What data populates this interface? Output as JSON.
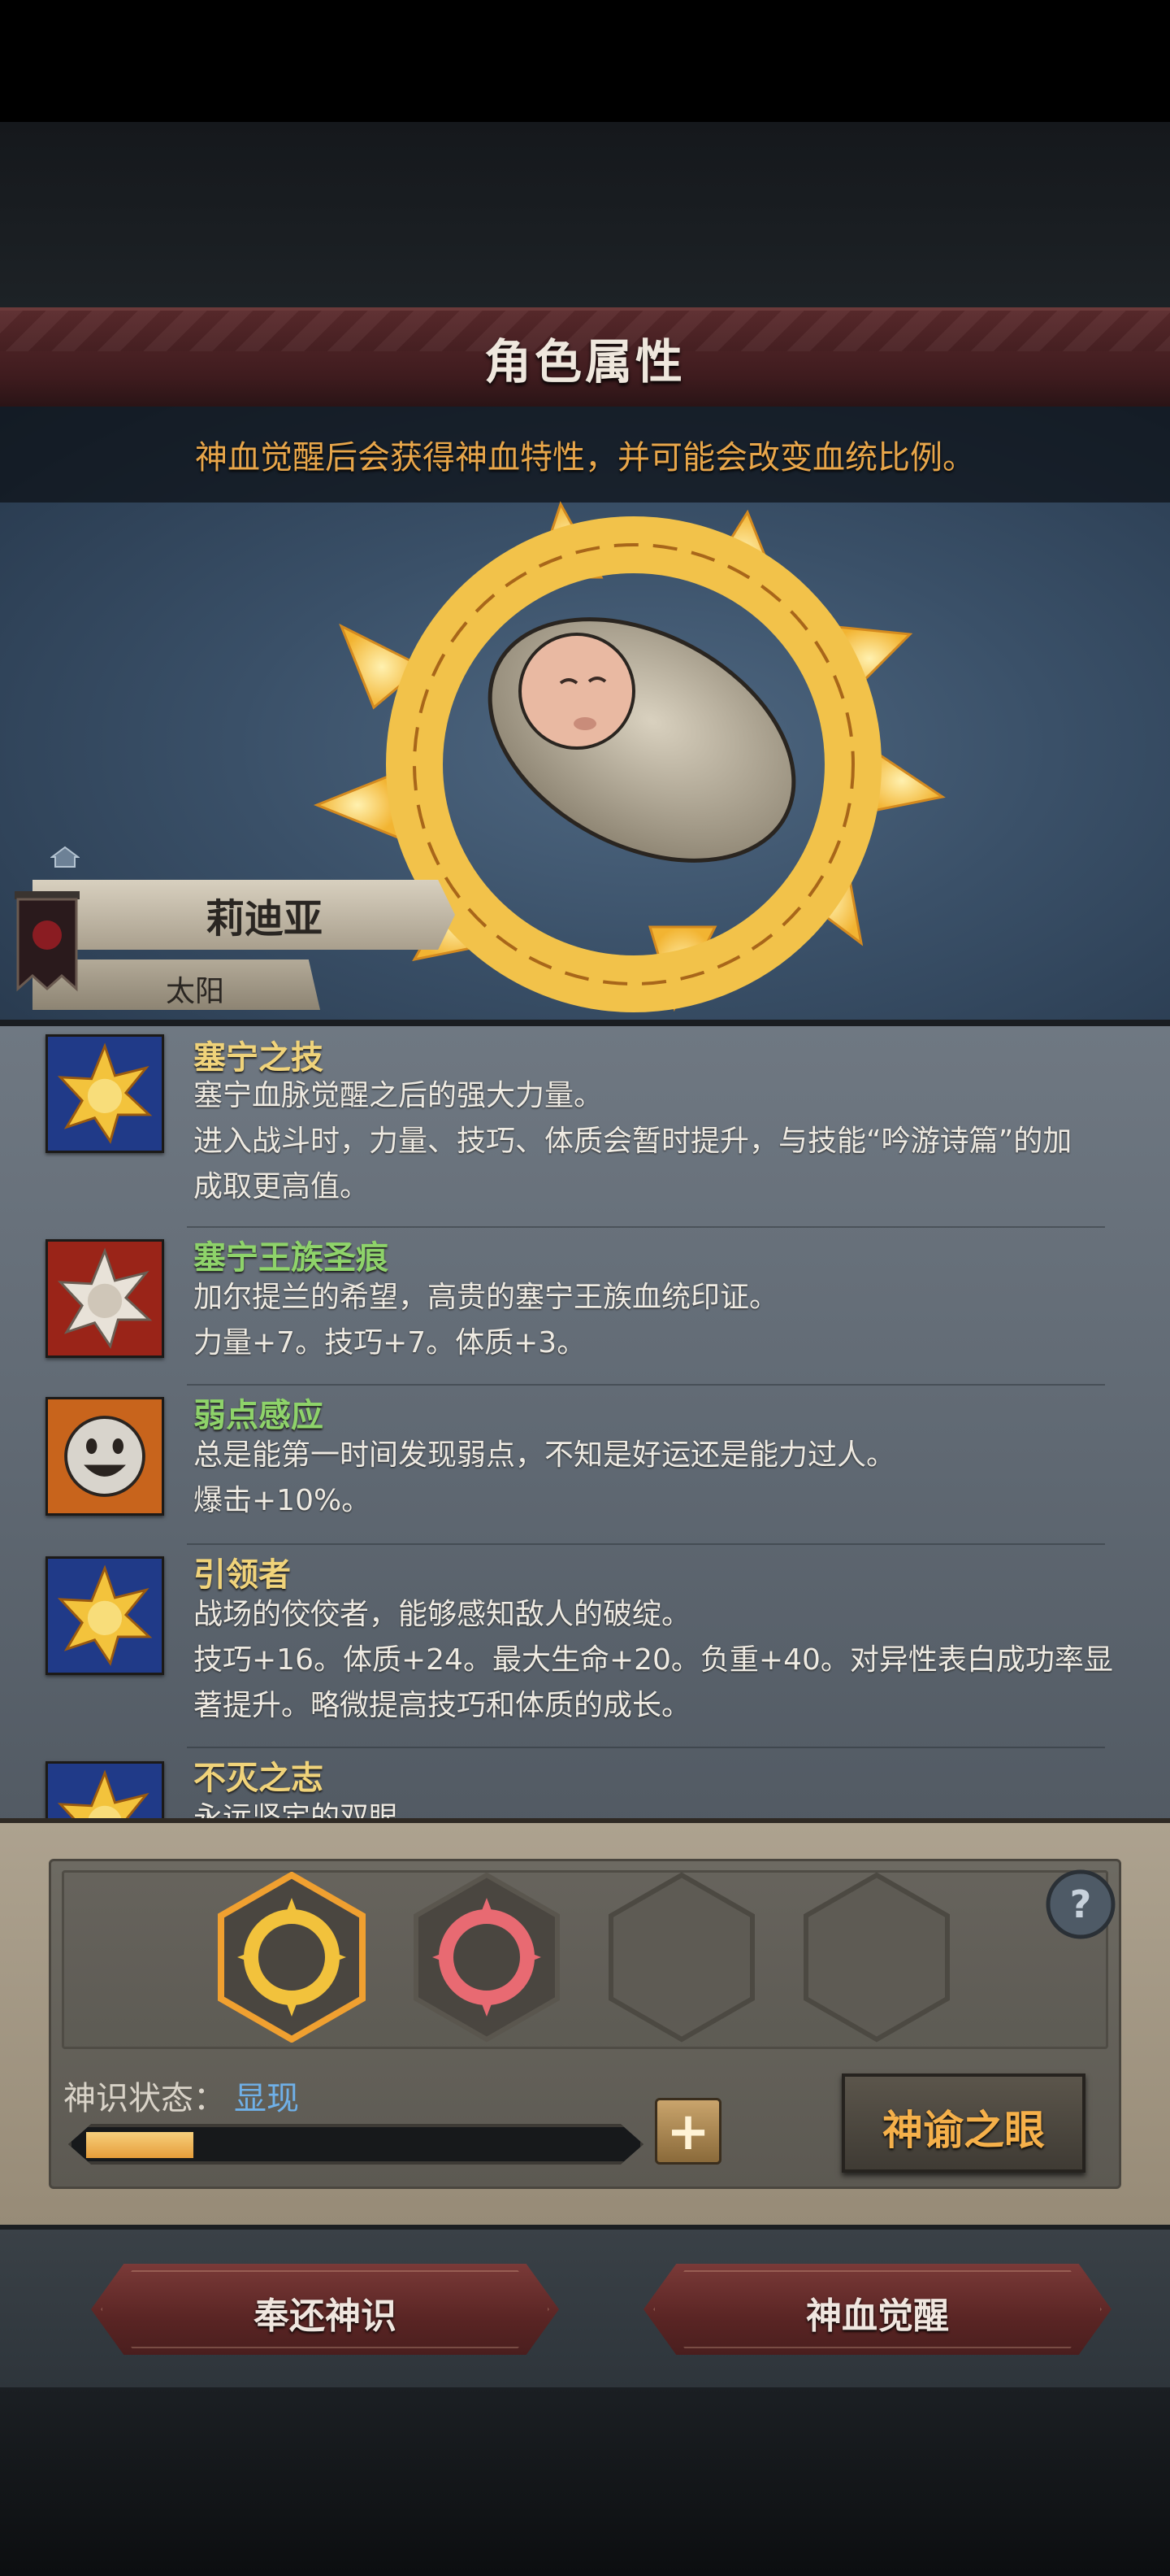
{
  "header": {
    "title": "角色属性",
    "subtitle": "神血觉醒后会获得神血特性，并可能会改变血统比例。"
  },
  "character": {
    "name": "莉迪亚",
    "title": "太阳",
    "portrait": "swaddled-baby-on-sun-emblem"
  },
  "traits": [
    {
      "name": "塞宁之技",
      "name_color": "#f0d37a",
      "icon": "golden-sun-icon",
      "lines": [
        "塞宁血脉觉醒之后的强大力量。",
        "进入战斗时，力量、技巧、体质会暂时提升，与技能“吟游诗篇”的加",
        "成取更高值。"
      ]
    },
    {
      "name": "塞宁王族圣痕",
      "name_color": "#8ed36a",
      "icon": "silver-sun-icon",
      "lines": [
        "加尔提兰的希望，高贵的塞宁王族血统印证。",
        "力量+7。技巧+7。体质+3。"
      ]
    },
    {
      "name": "弱点感应",
      "name_color": "#8ed36a",
      "icon": "smiley-face-icon",
      "lines": [
        "总是能第一时间发现弱点，不知是好运还是能力过人。",
        "爆击+10%。"
      ]
    },
    {
      "name": "引领者",
      "name_color": "#f0d37a",
      "icon": "golden-sun-icon",
      "lines": [
        "战场的佼佼者，能够感知敌人的破绽。",
        "技巧+16。体质+24。最大生命+20。负重+40。对异性表白成功率显",
        "著提升。略微提高技巧和体质的成长。"
      ]
    },
    {
      "name": "不灭之志",
      "name_color": "#f0d37a",
      "icon": "golden-sun-icon",
      "lines": [
        "永远坚定的双眼"
      ]
    }
  ],
  "slots": [
    "golden-sun-rune-icon",
    "red-sun-rune-icon",
    "empty-slot",
    "empty-slot"
  ],
  "divine": {
    "status_label": "神识状态：",
    "status_value": "显现",
    "progress": 0.2,
    "plus_label": "+",
    "oracle_button": "神谕之眼"
  },
  "actions": {
    "return_button": "奉还神识",
    "awaken_button": "神血觉醒"
  },
  "colors": {
    "accent_gold": "#f5b04a",
    "status_blue": "#6fb0e8",
    "title_red": "#5a2a2c"
  }
}
